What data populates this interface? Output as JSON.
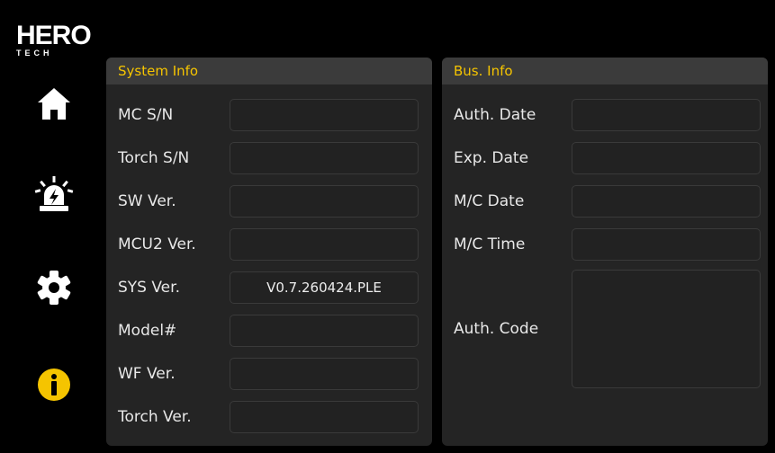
{
  "brand": {
    "name": "HERO",
    "sub": "TECH"
  },
  "nav": {
    "items": [
      {
        "icon": "home-icon",
        "active": false
      },
      {
        "icon": "alarm-icon",
        "active": false
      },
      {
        "icon": "gear-icon",
        "active": false
      },
      {
        "icon": "info-icon",
        "active": true
      }
    ],
    "active_color": "#f5c400",
    "inactive_color": "#ffffff"
  },
  "system_info": {
    "title": "System Info",
    "rows": [
      {
        "label": "MC S/N",
        "value": ""
      },
      {
        "label": "Torch S/N",
        "value": ""
      },
      {
        "label": "SW Ver.",
        "value": ""
      },
      {
        "label": "MCU2 Ver.",
        "value": ""
      },
      {
        "label": "SYS Ver.",
        "value": "V0.7.260424.PLE"
      },
      {
        "label": "Model#",
        "value": ""
      },
      {
        "label": "WF Ver.",
        "value": ""
      },
      {
        "label": "Torch Ver.",
        "value": ""
      }
    ]
  },
  "bus_info": {
    "title": "Bus. Info",
    "rows": [
      {
        "label": "Auth. Date",
        "value": ""
      },
      {
        "label": "Exp. Date",
        "value": ""
      },
      {
        "label": "M/C Date",
        "value": ""
      },
      {
        "label": "M/C Time",
        "value": ""
      }
    ],
    "auth_code": {
      "label": "Auth. Code",
      "value": ""
    }
  },
  "colors": {
    "accent": "#f5c400",
    "panel": "#242424",
    "header": "#3b3b3b",
    "background": "#000000"
  }
}
